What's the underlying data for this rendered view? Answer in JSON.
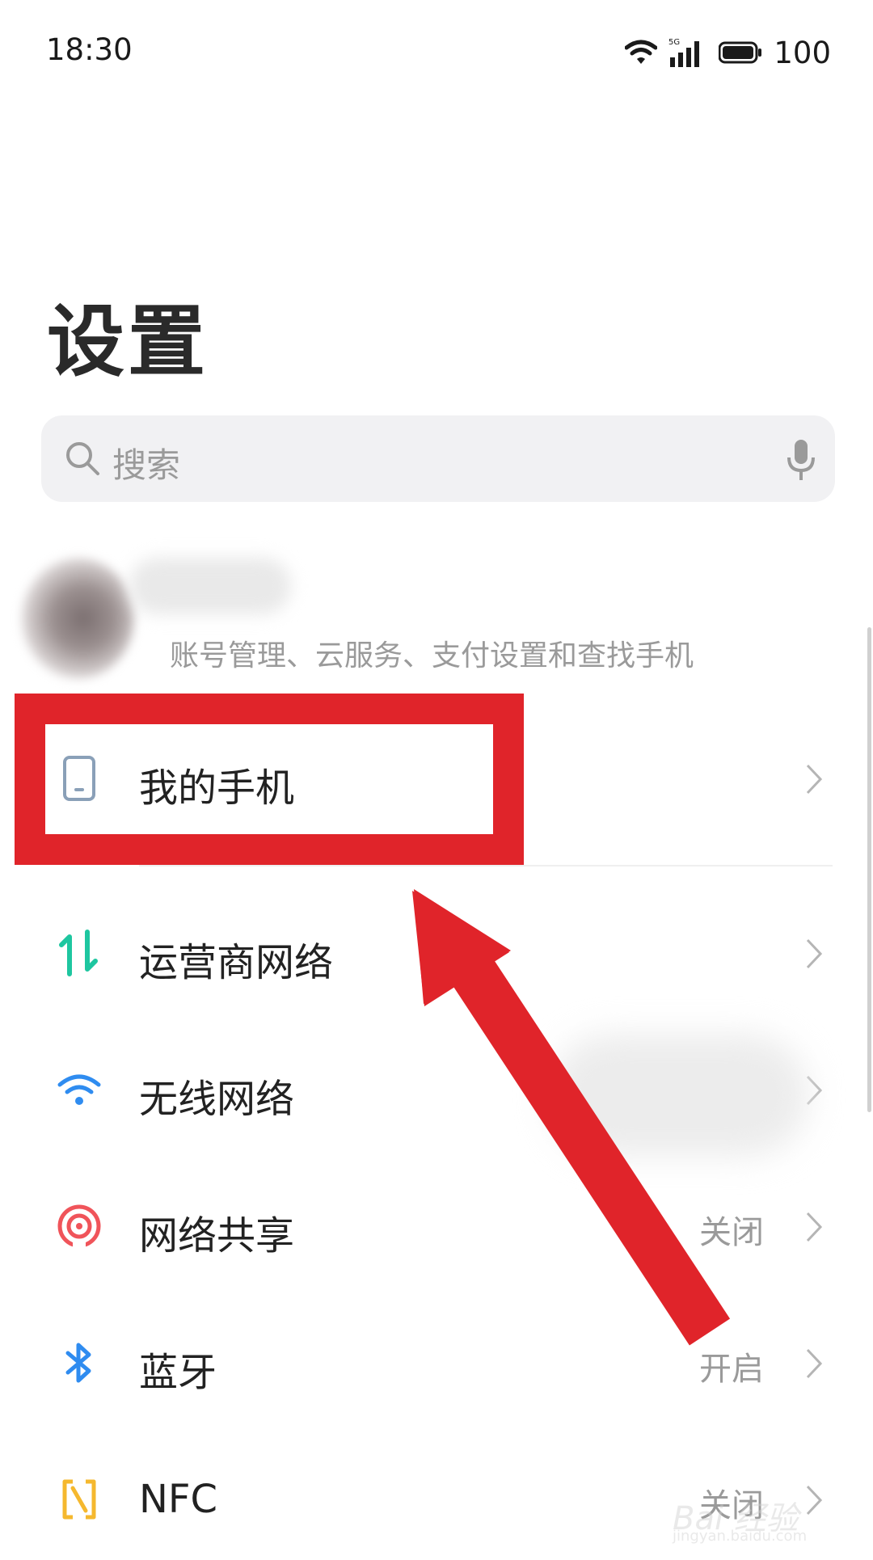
{
  "status_bar": {
    "time": "18:30",
    "network": "5G",
    "battery": "100"
  },
  "page_title": "设置",
  "search": {
    "placeholder": "搜索"
  },
  "account": {
    "subtitle": "账号管理、云服务、支付设置和查找手机"
  },
  "menu": [
    {
      "label": "我的手机",
      "value": "",
      "icon": "phone-icon",
      "color": "#8aa0b8"
    },
    {
      "label": "运营商网络",
      "value": "",
      "icon": "carrier-network-icon",
      "color": "#1ec6a0"
    },
    {
      "label": "无线网络",
      "value": "",
      "icon": "wifi-icon",
      "color": "#2f8cf0"
    },
    {
      "label": "网络共享",
      "value": "关闭",
      "icon": "hotspot-icon",
      "color": "#f0545a"
    },
    {
      "label": "蓝牙",
      "value": "开启",
      "icon": "bluetooth-icon",
      "color": "#2f8cf0"
    },
    {
      "label": "NFC",
      "value": "关闭",
      "icon": "nfc-icon",
      "color": "#f5b82e"
    }
  ],
  "annotation": {
    "color": "#e0242a"
  },
  "watermark": {
    "text": "Bai 经验",
    "url": "jingyan.baidu.com"
  }
}
